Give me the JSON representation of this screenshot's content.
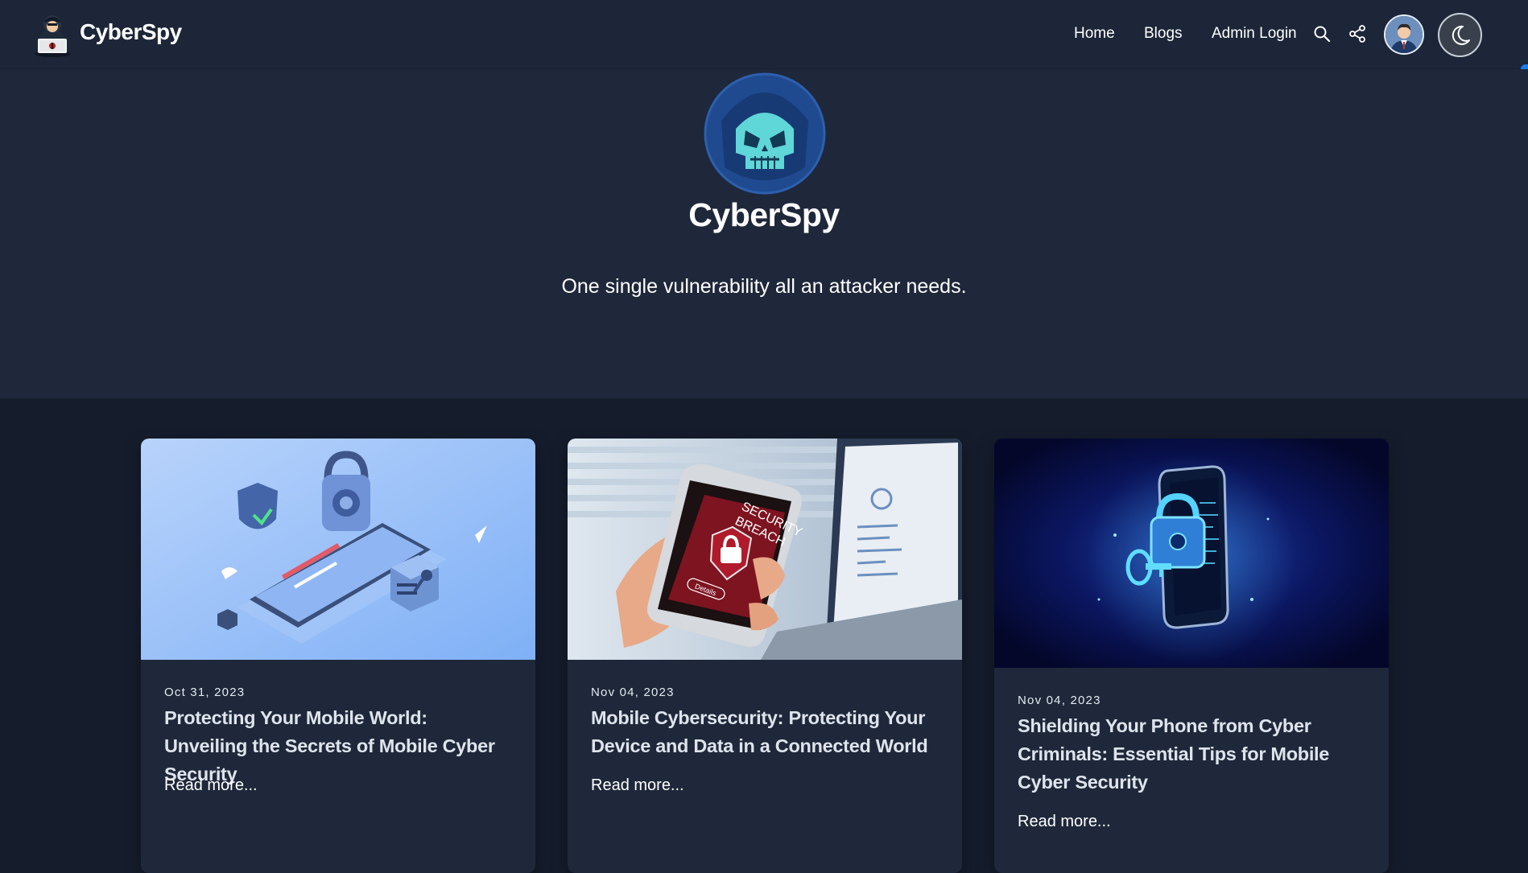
{
  "nav": {
    "brand": "CyberSpy",
    "links": [
      {
        "label": "Home"
      },
      {
        "label": "Blogs"
      },
      {
        "label": "Admin Login"
      }
    ],
    "icons": [
      "search-icon",
      "share-icon",
      "avatar",
      "moon-icon"
    ]
  },
  "hero": {
    "title": "CyberSpy",
    "tagline": "One single vulnerability all an attacker needs."
  },
  "posts": [
    {
      "date": "Oct 31, 2023",
      "title": "Protecting Your Mobile World: Unveiling the Secrets of Mobile Cyber Security",
      "read_more": "Read more..."
    },
    {
      "date": "Nov 04, 2023",
      "title": "Mobile Cybersecurity: Protecting Your Device and Data in a Connected World",
      "read_more": "Read more...",
      "image_text": {
        "line1": "SECURITY",
        "line2": "BREACH",
        "button": "Details"
      }
    },
    {
      "date": "Nov 04, 2023",
      "title": "Shielding Your Phone from Cyber Criminals: Essential Tips for Mobile Cyber Security",
      "read_more": "Read more..."
    }
  ],
  "colors": {
    "page_bg": "#151c2c",
    "nav_bg": "#1c2638",
    "hero_bg": "#1e283a",
    "card_bg": "#1e283a",
    "accent": "#1b7cf0"
  }
}
